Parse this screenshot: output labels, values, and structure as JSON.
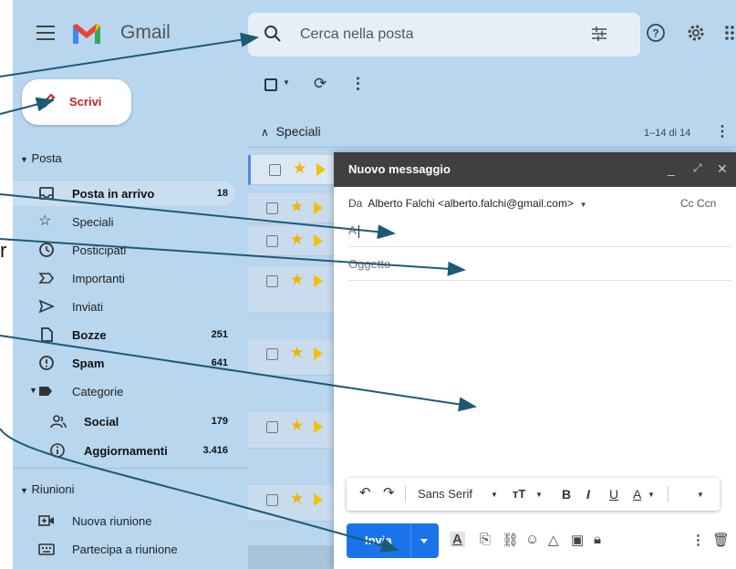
{
  "app": {
    "brand": "Gmail"
  },
  "search": {
    "placeholder": "Cerca nella posta"
  },
  "compose_button": {
    "label": "Scrivi"
  },
  "sidebar": {
    "section_posta": "Posta",
    "items": [
      {
        "label": "Posta in arrivo",
        "count": "18",
        "icon": "inbox-icon"
      },
      {
        "label": "Speciali",
        "count": "",
        "icon": "star-outline-icon"
      },
      {
        "label": "Posticipati",
        "count": "",
        "icon": "clock-icon"
      },
      {
        "label": "Importanti",
        "count": "",
        "icon": "important-icon"
      },
      {
        "label": "Inviati",
        "count": "",
        "icon": "send-icon"
      },
      {
        "label": "Bozze",
        "count": "251",
        "icon": "draft-icon"
      },
      {
        "label": "Spam",
        "count": "641",
        "icon": "spam-icon"
      }
    ],
    "categorie": "Categorie",
    "sub": [
      {
        "label": "Social",
        "count": "179",
        "icon": "people-icon"
      },
      {
        "label": "Aggiornamenti",
        "count": "3.416",
        "icon": "info-icon"
      }
    ],
    "section_riunioni": "Riunioni",
    "meet": [
      {
        "label": "Nuova riunione",
        "icon": "video-icon"
      },
      {
        "label": "Partecipa a riunione",
        "icon": "keyboard-icon"
      }
    ]
  },
  "list": {
    "section": "Speciali",
    "pagination": "1–14 di 14"
  },
  "compose": {
    "title": "Nuovo messaggio",
    "from_label": "Da",
    "from_value": "Alberto Falchi <alberto.falchi@gmail.com>",
    "cc_ccn": "Cc Ccn",
    "to_label": "A",
    "subject_placeholder": "Oggetto",
    "font": "Sans Serif",
    "send_label": "Invia"
  },
  "stray_text": "r",
  "colors": {
    "accent": "#1a73e8",
    "compose_red": "#c5221f",
    "arrow": "#1d5a74",
    "bg": "#b8d6ee"
  }
}
